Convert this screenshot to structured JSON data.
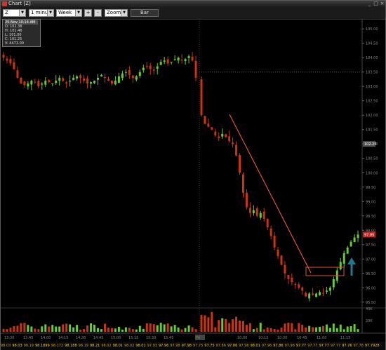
{
  "window": {
    "title": "Chart [Z]"
  },
  "toolbar": {
    "symbol": "Z",
    "interval": "1 minute",
    "range": "Week",
    "plus_label": "+",
    "minus_label": "-",
    "zoom_label": "Zoom",
    "bar_label": "Bar"
  },
  "ohlc_box": {
    "header": "25-Nov 10:14 AM",
    "open": "O: 101.38",
    "high": "H: 101.46",
    "low": "L: 101.00",
    "close": "C: 101.25",
    "volume": "V: 4473.00"
  },
  "colors": {
    "up": "#66cc33",
    "down": "#cc3311",
    "trendline": "#dd5533",
    "arrow": "#1f7a8c",
    "price_tag": "#cc2222"
  },
  "icons": [
    "app-icon",
    "minimize-icon",
    "maximize-icon",
    "close-icon",
    "dropdown-arrow-icon",
    "arrow-up-icon"
  ],
  "chart_data": {
    "type": "candlestick",
    "y_axis_labels": [
      "105.00",
      "104.50",
      "104.00",
      "103.50",
      "103.00",
      "102.50",
      "102.00",
      "101.50",
      "101.00",
      "100.50",
      "100.00",
      "99.50",
      "99.00",
      "98.50",
      "98.00",
      "97.50",
      "97.00",
      "96.50",
      "96.00",
      "95.50"
    ],
    "price_tags": [
      "102.25",
      "97.85"
    ],
    "volume_axis_labels": [
      "40K",
      "20K"
    ],
    "x_axis_labels": [
      "13:30",
      "13:45",
      "14:00",
      "14:15",
      "14:30",
      "14:45",
      "15:00",
      "15:15",
      "15:30",
      "15:45",
      "Fri",
      "10:00",
      "10:15",
      "10:30",
      "10:45",
      "11:00",
      "11:15"
    ],
    "x_axis_marker": "Fri",
    "ylim": [
      95.3,
      105.2
    ],
    "approx_closes": [
      104.0,
      103.9,
      103.8,
      103.6,
      103.3,
      103.1,
      103.05,
      103.1,
      103.2,
      103.15,
      103.0,
      103.1,
      103.2,
      103.15,
      103.1,
      103.2,
      103.3,
      103.2,
      103.1,
      103.2,
      103.3,
      103.35,
      103.3,
      103.2,
      103.1,
      103.15,
      103.2,
      103.3,
      103.4,
      103.3,
      103.2,
      103.1,
      103.2,
      103.35,
      103.45,
      103.5,
      103.4,
      103.3,
      103.35,
      103.5,
      103.65,
      103.7,
      103.6,
      103.55,
      103.7,
      103.85,
      103.9,
      103.8,
      103.85,
      103.95,
      104.0,
      103.9,
      103.95,
      104.05,
      103.9,
      103.3,
      102.0,
      101.7,
      101.6,
      101.5,
      101.3,
      101.2,
      101.35,
      101.25,
      101.1,
      101.0,
      100.6,
      100.0,
      99.3,
      98.8,
      98.6,
      98.7,
      98.5,
      98.6,
      98.4,
      98.1,
      97.8,
      97.4,
      97.1,
      96.8,
      96.5,
      96.3,
      96.2,
      96.1,
      96.0,
      95.9,
      95.7,
      95.8,
      95.75,
      95.8,
      95.85,
      95.8,
      95.9,
      96.0,
      96.3,
      96.6,
      96.9,
      97.2,
      97.4,
      97.6,
      97.75,
      97.85
    ],
    "footer_values": [
      "98.03",
      "98.03",
      "98.19",
      "98.1899",
      "98.172",
      "98.188",
      "98.19",
      "98.21",
      "98.02",
      "98.01",
      "98.02",
      "98.01",
      "97.93",
      "97.96",
      "97.98",
      "97.98",
      "97.75",
      "97.75",
      "97.86",
      "97.86",
      "97.98",
      "98.01",
      "97.96",
      "97.86",
      "97.98",
      "97.77",
      "97.77",
      "97.77",
      "97.77",
      "97.76",
      "97.78",
      "97.7928"
    ]
  }
}
